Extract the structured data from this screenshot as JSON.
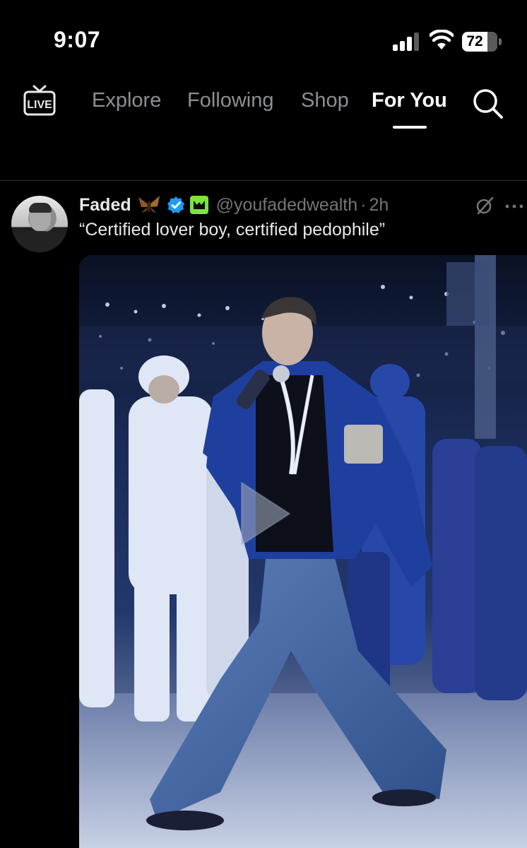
{
  "status_bar": {
    "time": "9:07",
    "battery": "72",
    "battery_level_percent": 72
  },
  "nav": {
    "live_label": "LIVE",
    "tabs": [
      {
        "label": "Explore",
        "active": false
      },
      {
        "label": "Following",
        "active": false
      },
      {
        "label": "Shop",
        "active": false
      },
      {
        "label": "For You",
        "active": true
      }
    ]
  },
  "post": {
    "display_name": "Faded",
    "handle": "@youfadedwealth",
    "separator": "·",
    "time": "2h",
    "text": "“Certified lover boy, certified pedophile”",
    "media_type": "video"
  },
  "colors": {
    "background": "#000000",
    "text_primary": "#e7e9ea",
    "text_secondary": "#71767b",
    "verified_blue": "#1d9bf0",
    "affiliate_green": "#7ee33b",
    "divider": "#2f3336"
  },
  "icons": {
    "live": "live-tv-icon",
    "search": "search-icon",
    "verified": "verified-badge-icon",
    "affiliate": "affiliate-badge-icon",
    "emoji": "moth-emoji-icon",
    "grok": "grok-icon",
    "more": "more-icon",
    "play": "play-icon"
  }
}
